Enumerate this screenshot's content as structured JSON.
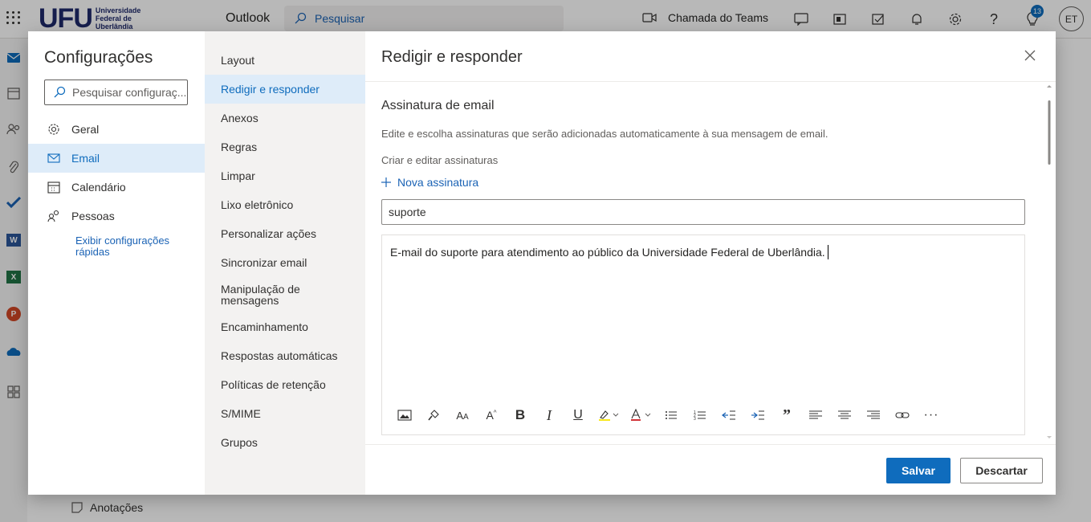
{
  "topbar": {
    "logo_mark": "UFU",
    "logo_sub": [
      "Universidade",
      "Federal de",
      "Uberlândia"
    ],
    "app_name": "Outlook",
    "search_placeholder": "Pesquisar",
    "teams_call": "Chamada do Teams",
    "notification_badge": "13",
    "avatar_initials": "ET"
  },
  "background": {
    "notes_label": "Anotações"
  },
  "settings": {
    "title": "Configurações",
    "search_placeholder": "Pesquisar configuraç...",
    "categories": [
      {
        "label": "Geral",
        "icon": "gear-icon",
        "selected": false
      },
      {
        "label": "Email",
        "icon": "mail-icon",
        "selected": true
      },
      {
        "label": "Calendário",
        "icon": "calendar-icon",
        "selected": false
      },
      {
        "label": "Pessoas",
        "icon": "people-icon",
        "selected": false
      }
    ],
    "quick_settings_link": "Exibir configurações rápidas"
  },
  "email_sections": [
    {
      "label": "Layout",
      "selected": false
    },
    {
      "label": "Redigir e responder",
      "selected": true
    },
    {
      "label": "Anexos",
      "selected": false
    },
    {
      "label": "Regras",
      "selected": false
    },
    {
      "label": "Limpar",
      "selected": false
    },
    {
      "label": "Lixo eletrônico",
      "selected": false
    },
    {
      "label": "Personalizar ações",
      "selected": false
    },
    {
      "label": "Sincronizar email",
      "selected": false
    },
    {
      "label": "Manipulação de mensagens",
      "selected": false
    },
    {
      "label": "Encaminhamento",
      "selected": false
    },
    {
      "label": "Respostas automáticas",
      "selected": false
    },
    {
      "label": "Políticas de retenção",
      "selected": false
    },
    {
      "label": "S/MIME",
      "selected": false
    },
    {
      "label": "Grupos",
      "selected": false
    }
  ],
  "panel": {
    "title": "Redigir e responder",
    "section_title": "Assinatura de email",
    "description": "Edite e escolha assinaturas que serão adicionadas automaticamente à sua mensagem de email.",
    "create_edit_label": "Criar e editar assinaturas",
    "new_signature_label": "Nova assinatura",
    "signature_name_value": "suporte",
    "signature_body": "E-mail do suporte para atendimento ao público da Universidade Federal de Uberlândia.",
    "toolbar_icons": [
      "insert-image-icon",
      "format-painter-icon",
      "font-size-icon",
      "font-grow-icon",
      "bold-icon",
      "italic-icon",
      "underline-icon",
      "highlight-icon",
      "font-color-icon",
      "bullets-icon",
      "numbering-icon",
      "decrease-indent-icon",
      "increase-indent-icon",
      "quote-icon",
      "align-left-icon",
      "align-center-icon",
      "align-right-icon",
      "link-icon",
      "more-options-icon"
    ],
    "save_label": "Salvar",
    "discard_label": "Descartar"
  },
  "colors": {
    "accent": "#0f6cbd",
    "selected_bg": "#deecf9"
  }
}
